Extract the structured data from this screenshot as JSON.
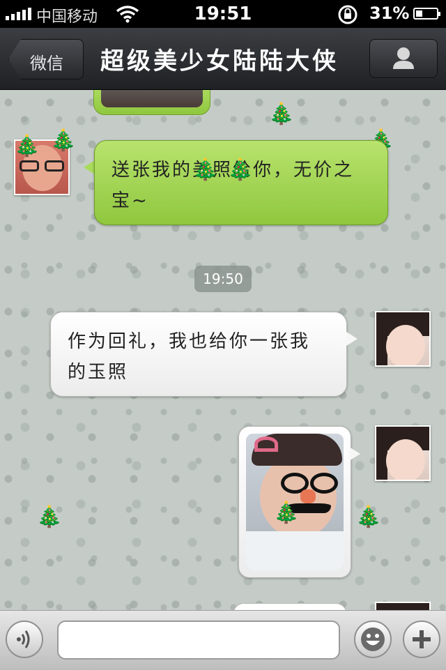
{
  "status_bar": {
    "carrier": "中国移动",
    "time": "19:51",
    "battery_percent_text": "31%",
    "battery_level": 0.31
  },
  "nav": {
    "back_label": "微信",
    "title": "超级美少女陆陆大侠",
    "profile_icon": "person-icon"
  },
  "messages": [
    {
      "sender": "friend",
      "type": "text",
      "text": "送张我的美照给你，无价之宝~"
    },
    {
      "type": "timestamp",
      "text": "19:50"
    },
    {
      "sender": "me",
      "type": "text",
      "text": "作为回礼，我也给你一张我的玉照"
    },
    {
      "sender": "me",
      "type": "image"
    }
  ],
  "input": {
    "value": "",
    "placeholder": "",
    "voice_icon": "voice-icon",
    "emoji_icon": "emoji-icon",
    "plus_icon": "plus-icon"
  },
  "colors": {
    "friend_bubble": "#9fd34e",
    "me_bubble": "#ffffff",
    "nav_bar": "#2b2d30"
  }
}
